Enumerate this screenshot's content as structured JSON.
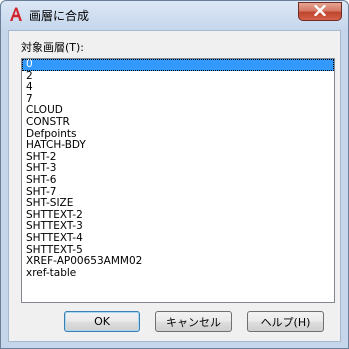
{
  "window": {
    "title": "画層に合成",
    "close_label": "X"
  },
  "list_label": "対象画層(T):",
  "layers": [
    "0",
    "2",
    "4",
    "7",
    "CLOUD",
    "CONSTR",
    "Defpoints",
    "HATCH-BDY",
    "SHT-2",
    "SHT-3",
    "SHT-6",
    "SHT-7",
    "SHT-SIZE",
    "SHTTEXT-2",
    "SHTTEXT-3",
    "SHTTEXT-4",
    "SHTTEXT-5",
    "XREF-AP00653AMM02",
    "xref-table"
  ],
  "selected_index": 0,
  "buttons": {
    "ok": "OK",
    "cancel": "キャンセル",
    "help": "ヘルプ(H)"
  },
  "colors": {
    "selection": "#3399ff",
    "app_icon": "#d2232a"
  }
}
